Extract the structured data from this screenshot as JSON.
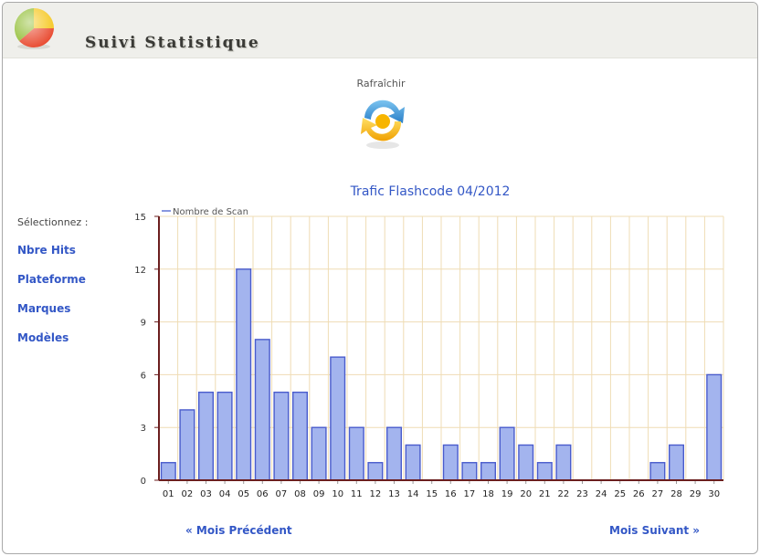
{
  "header": {
    "title": "Suivi Statistique"
  },
  "toolbar": {
    "refresh_label": "Rafraîchir"
  },
  "sidebar": {
    "prompt": "Sélectionnez :",
    "items": [
      {
        "label": "Nbre Hits"
      },
      {
        "label": "Plateforme"
      },
      {
        "label": "Marques"
      },
      {
        "label": "Modèles"
      }
    ]
  },
  "nav": {
    "prev_label": "« Mois Précédent",
    "next_label": "Mois Suivant »"
  },
  "colors": {
    "bar_fill": "#a3b4ee",
    "bar_stroke": "#4a5ccc",
    "grid": "#efdcb4",
    "axis": "#6b1e1e",
    "link": "#3357c6"
  },
  "chart_data": {
    "type": "bar",
    "title": "Trafic Flashcode 04/2012",
    "legend_position": "top-left",
    "grid": true,
    "categories": [
      "01",
      "02",
      "03",
      "04",
      "05",
      "06",
      "07",
      "08",
      "09",
      "10",
      "11",
      "12",
      "13",
      "14",
      "15",
      "16",
      "17",
      "18",
      "19",
      "20",
      "21",
      "22",
      "23",
      "24",
      "25",
      "26",
      "27",
      "28",
      "29",
      "30"
    ],
    "series": [
      {
        "name": "Nombre de Scan",
        "values": [
          1,
          4,
          5,
          5,
          12,
          8,
          5,
          5,
          3,
          7,
          3,
          1,
          3,
          2,
          0,
          2,
          1,
          1,
          3,
          2,
          1,
          2,
          0,
          0,
          0,
          0,
          1,
          2,
          0,
          6
        ]
      }
    ],
    "ylim": [
      0,
      15
    ],
    "yticks": [
      0,
      3,
      6,
      9,
      12,
      15
    ]
  }
}
